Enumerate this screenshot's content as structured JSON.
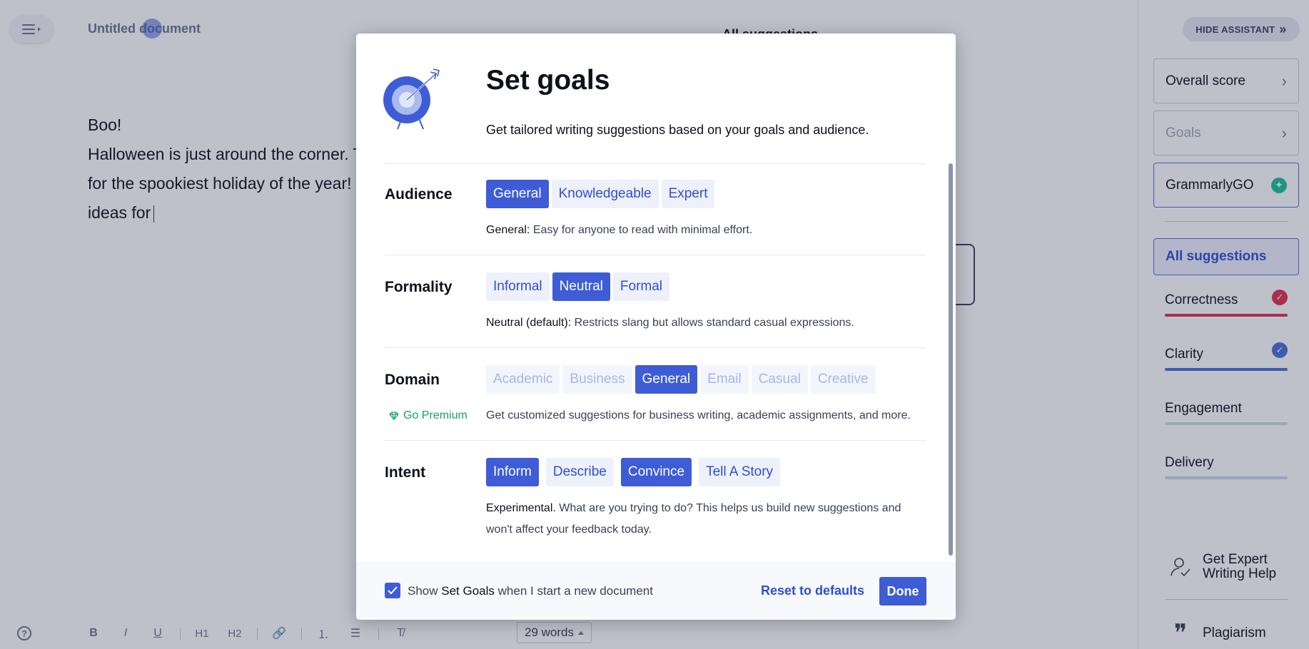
{
  "editor": {
    "doc_title": "Untitled document",
    "lines": [
      "Boo!",
      "Halloween is just around the corner. T",
      "for the spookiest holiday of the year!",
      "ideas for"
    ],
    "background_heading": "All suggestions"
  },
  "toolbar": {
    "help": "?",
    "bold": "B",
    "italic": "I",
    "underline": "U",
    "h1": "H1",
    "h2": "H2",
    "link": "🔗",
    "ordered": "⒈",
    "bullets": "☰",
    "clear": "T̸",
    "word_count": "29 words"
  },
  "sidebar": {
    "hide_assistant": "HIDE ASSISTANT",
    "hide_icon": "»",
    "overall_score": "Overall score",
    "goals": "Goals",
    "grammarlygo": "GrammarlyGO",
    "all_suggestions": "All suggestions",
    "categories": [
      {
        "label": "Correctness",
        "color": "#e0304e"
      },
      {
        "label": "Clarity",
        "color": "#4a6fd8"
      },
      {
        "label": "Engagement",
        "color": "#c8e3e0"
      },
      {
        "label": "Delivery",
        "color": "#cfd4e8"
      }
    ],
    "expert_help": [
      "Get Expert",
      "Writing Help"
    ],
    "plagiarism": "Plagiarism"
  },
  "modal": {
    "title": "Set goals",
    "subtitle": "Get tailored writing suggestions based on your goals and audience.",
    "audience": {
      "label": "Audience",
      "options": [
        "General",
        "Knowledgeable",
        "Expert"
      ],
      "selected": "General",
      "hint_key": "General:",
      "hint_text": " Easy for anyone to read with minimal effort."
    },
    "formality": {
      "label": "Formality",
      "options": [
        "Informal",
        "Neutral",
        "Formal"
      ],
      "selected": "Neutral",
      "hint_key": "Neutral (default):",
      "hint_text": " Restricts slang but allows standard casual expressions."
    },
    "domain": {
      "label": "Domain",
      "options": [
        "Academic",
        "Business",
        "General",
        "Email",
        "Casual",
        "Creative"
      ],
      "selected": "General",
      "premium_link": "Go Premium",
      "hint_text": "Get customized suggestions for business writing, academic assignments, and more."
    },
    "intent": {
      "label": "Intent",
      "options": [
        "Inform",
        "Describe",
        "Convince",
        "Tell A Story"
      ],
      "selected": [
        "Inform",
        "Convince"
      ],
      "hint_key": "Experimental.",
      "hint_line1": " What are you trying to do? This helps us build new suggestions and",
      "hint_line2": "won't affect your feedback today."
    },
    "footer": {
      "checkbox_checked": true,
      "check_pre": "Show ",
      "check_key": "Set Goals",
      "check_post": " when I start a new document",
      "reset": "Reset to defaults",
      "done": "Done"
    }
  }
}
